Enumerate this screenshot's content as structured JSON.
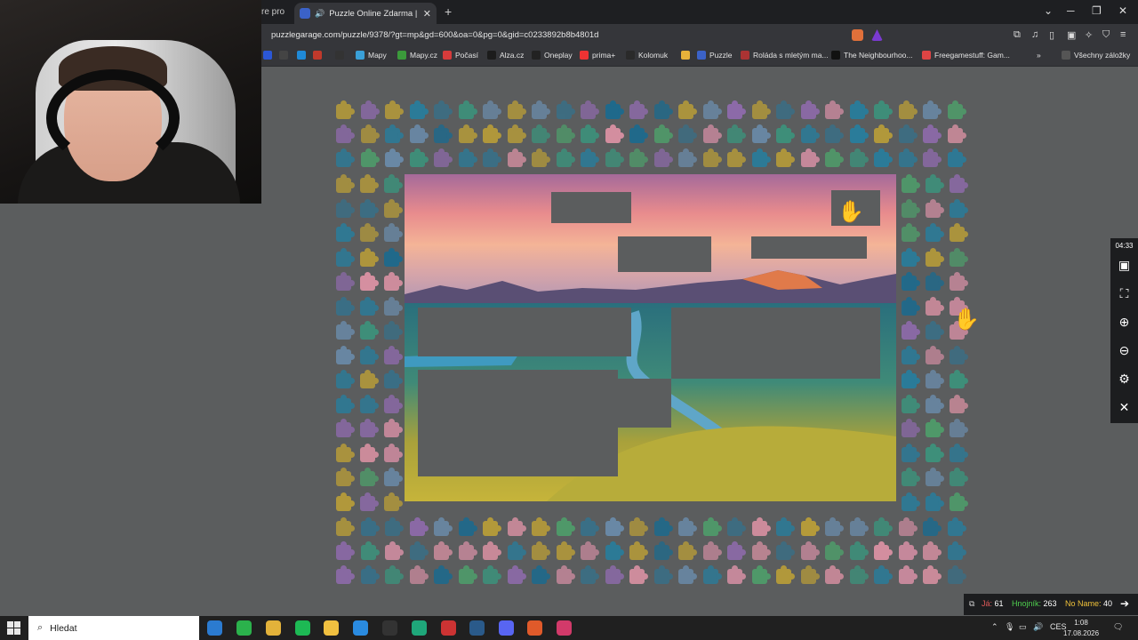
{
  "browser": {
    "prev_tab_fragment": "re pro",
    "active_tab_title": "Puzzle Online Zdarma | Puzzle",
    "url": "puzzlegarage.com/puzzle/9378/?gt=mp&gd=600&oa=0&pg=0&gid=c0233892b8b4801d"
  },
  "bookmarks": [
    {
      "label": "",
      "icon": "teal-square-icon",
      "color": "#2b57d6"
    },
    {
      "label": "",
      "icon": "c-icon",
      "color": "#444"
    },
    {
      "label": "",
      "icon": "h-icon",
      "color": "#1f8ad8"
    },
    {
      "label": "",
      "icon": "red-icon",
      "color": "#c0392b"
    },
    {
      "label": "",
      "icon": "arrow-icon",
      "color": "#333"
    },
    {
      "label": "Mapy",
      "icon": "map-pin-icon",
      "color": "#3aa0d8"
    },
    {
      "label": "Mapy.cz",
      "icon": "mapy-icon",
      "color": "#3b9a3b"
    },
    {
      "label": "Počasí",
      "icon": "weather-icon",
      "color": "#d63b3b"
    },
    {
      "label": "Alza.cz",
      "icon": "alza-icon",
      "color": "#1c1c1c"
    },
    {
      "label": "Oneplay",
      "icon": "oneplay-icon",
      "color": "#222"
    },
    {
      "label": "prima+",
      "icon": "prima-icon",
      "color": "#e33"
    },
    {
      "label": "Kolomuk",
      "icon": "kolomuk-icon",
      "color": "#2a2a2a"
    },
    {
      "label": "",
      "icon": "chrome-icon",
      "color": "#e8b23a"
    },
    {
      "label": "Puzzle",
      "icon": "puzzle-icon",
      "color": "#3b62c8"
    },
    {
      "label": "Roláda s mletým ma...",
      "icon": "recipe-icon",
      "color": "#a33"
    },
    {
      "label": "The Neighbourhoo...",
      "icon": "tm-icon",
      "color": "#111"
    },
    {
      "label": "Freegamestuff: Gam...",
      "icon": "game-icon",
      "color": "#d44"
    },
    {
      "label": "Všechny záložky",
      "icon": "folder-icon",
      "color": "#555"
    }
  ],
  "sidebar": {
    "timer": "04:33",
    "buttons": [
      "image-icon",
      "fullscreen-icon",
      "zoom-in-icon",
      "zoom-out-icon",
      "settings-icon",
      "close-icon"
    ]
  },
  "scores": [
    {
      "name": "Já:",
      "value": "61",
      "color": "#e05a5a"
    },
    {
      "name": "Hnojník:",
      "value": "263",
      "color": "#4fd04f"
    },
    {
      "name": "No Name:",
      "value": "40",
      "color": "#f0c23a"
    }
  ],
  "taskbar": {
    "search_label": "Hledat",
    "lang": "CES",
    "time": "1:08",
    "date": "17.08.2026"
  },
  "colors": {
    "background": "#5b5d5e",
    "piece_palette": [
      "#2a7c9a",
      "#8c6aa8",
      "#3e8f7a",
      "#c7899c",
      "#b49a3a",
      "#3a6f86",
      "#6a8aa8",
      "#4f9a6a",
      "#d58fa0",
      "#1f6a8c"
    ]
  }
}
